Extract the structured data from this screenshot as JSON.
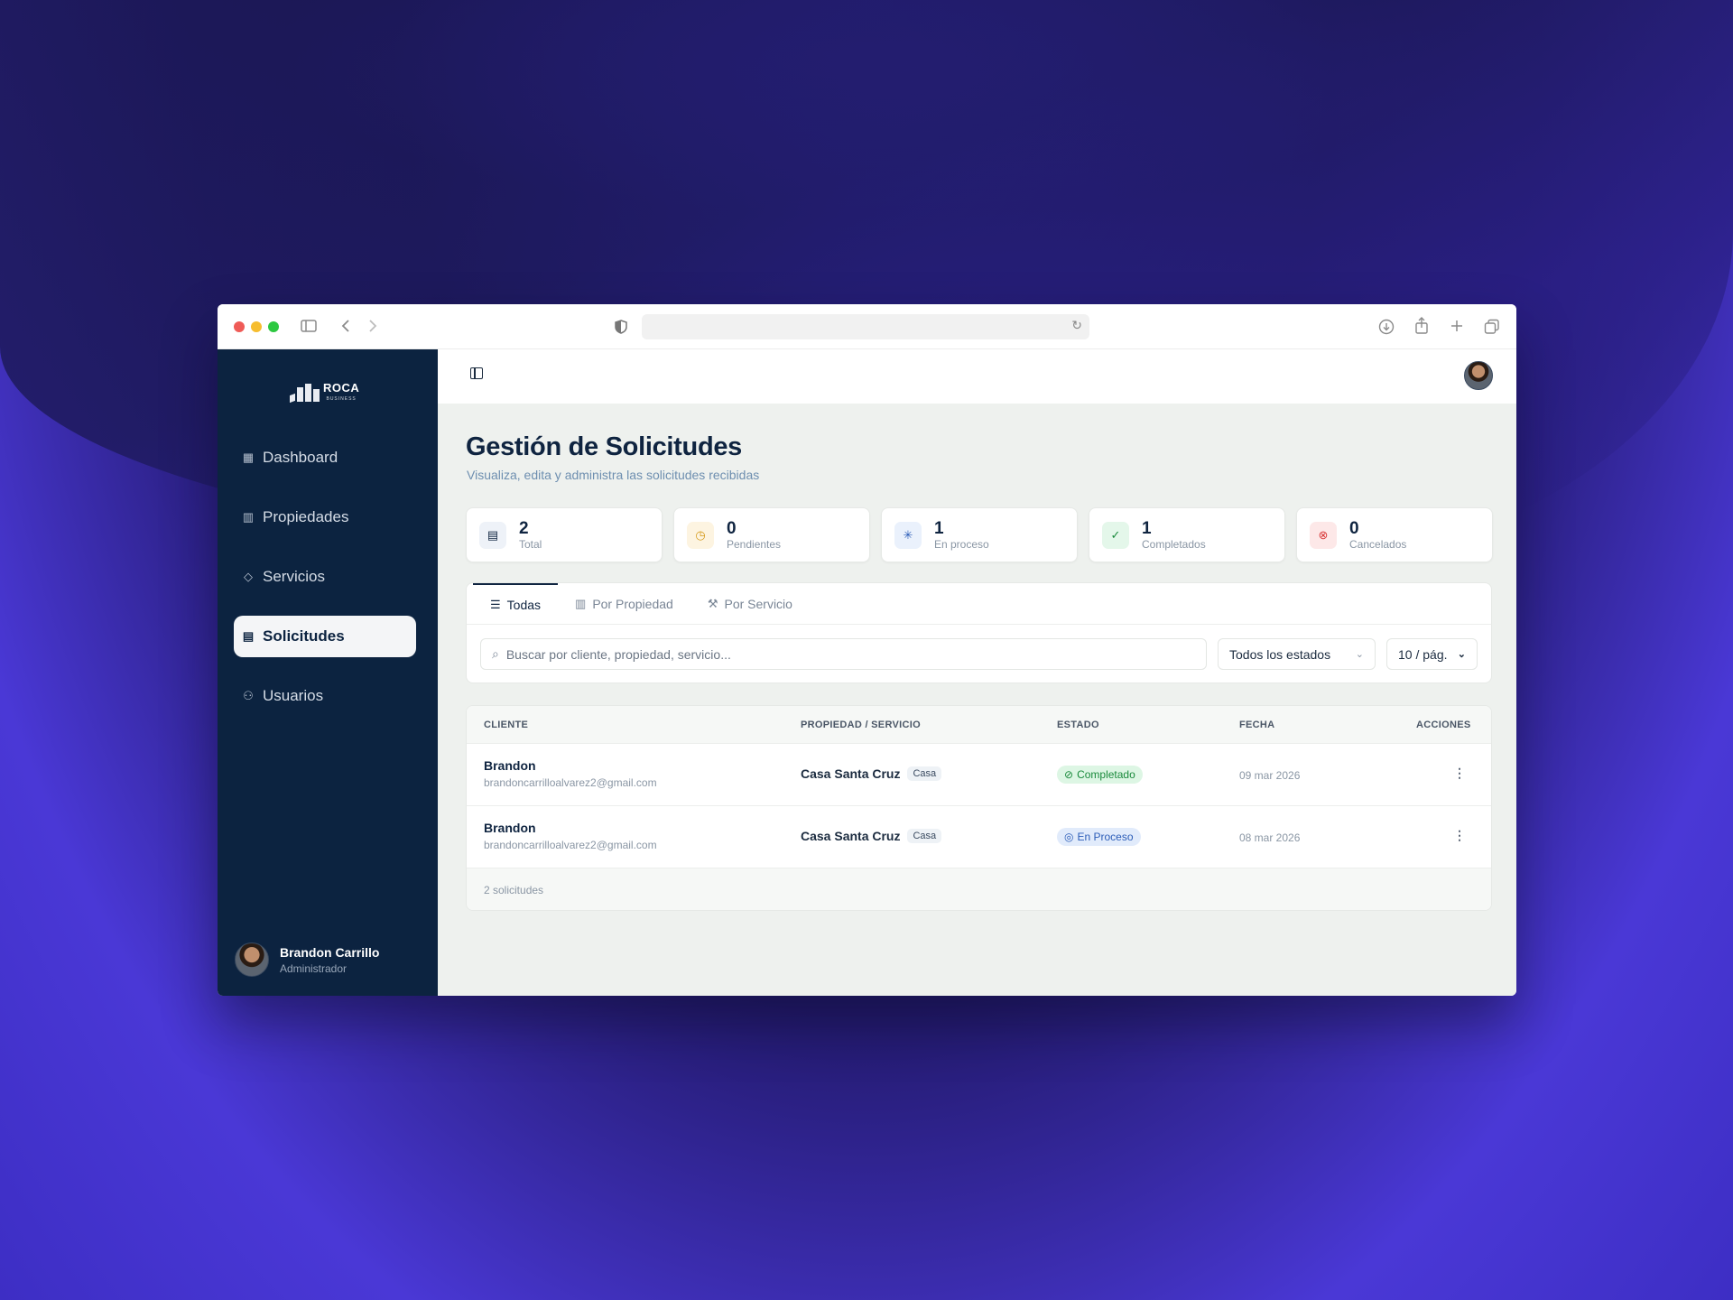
{
  "colors": {
    "sidebar": "#0c2340",
    "accent": "#0f2440",
    "dot_red": "#ef5b57",
    "dot_yellow": "#f6bd2f",
    "dot_green": "#2dc841",
    "done": "#1a8a3c",
    "process": "#2c5db8",
    "cancel": "#d93a3a",
    "pending": "#d59a1a"
  },
  "browser": {
    "icons": [
      "sidebar-toggle-icon",
      "back-icon",
      "forward-icon",
      "shield-icon",
      "reload-icon",
      "download-icon",
      "share-icon",
      "new-tab-icon",
      "tabs-icon"
    ]
  },
  "sidebar": {
    "logo_text": "ROCA",
    "logo_sub": "BUSINESS",
    "items": [
      {
        "label": "Dashboard",
        "icon": "grid-icon"
      },
      {
        "label": "Propiedades",
        "icon": "building-icon"
      },
      {
        "label": "Servicios",
        "icon": "tag-icon"
      },
      {
        "label": "Solicitudes",
        "icon": "clipboard-icon"
      },
      {
        "label": "Usuarios",
        "icon": "users-icon"
      }
    ],
    "user": {
      "name": "Brandon Carrillo",
      "role": "Administrador"
    }
  },
  "header": {
    "title": "Gestión de Solicitudes",
    "subtitle": "Visualiza, edita y administra las solicitudes recibidas"
  },
  "stats": [
    {
      "value": "2",
      "label": "Total",
      "icon": "clipboard-icon"
    },
    {
      "value": "0",
      "label": "Pendientes",
      "icon": "clock-icon"
    },
    {
      "value": "1",
      "label": "En proceso",
      "icon": "loader-icon"
    },
    {
      "value": "1",
      "label": "Completados",
      "icon": "check-circle-icon"
    },
    {
      "value": "0",
      "label": "Cancelados",
      "icon": "x-circle-icon"
    }
  ],
  "tabs": [
    {
      "label": "Todas",
      "icon": "list-icon"
    },
    {
      "label": "Por Propiedad",
      "icon": "building-icon"
    },
    {
      "label": "Por Servicio",
      "icon": "wrench-icon"
    }
  ],
  "filters": {
    "search_placeholder": "Buscar por cliente, propiedad, servicio...",
    "status": "Todos los estados",
    "page_size": "10 / pág."
  },
  "table": {
    "headers": {
      "client": "CLIENTE",
      "property": "PROPIEDAD / SERVICIO",
      "status": "ESTADO",
      "date": "FECHA",
      "actions": "ACCIONES"
    },
    "rows": [
      {
        "name": "Brandon",
        "email": "brandoncarrilloalvarez2@gmail.com",
        "property": "Casa Santa Cruz",
        "tag": "Casa",
        "status": "Completado",
        "date": "09 mar 2026"
      },
      {
        "name": "Brandon",
        "email": "brandoncarrilloalvarez2@gmail.com",
        "property": "Casa Santa Cruz",
        "tag": "Casa",
        "status": "En Proceso",
        "date": "08 mar 2026"
      }
    ],
    "footer": "2 solicitudes"
  }
}
